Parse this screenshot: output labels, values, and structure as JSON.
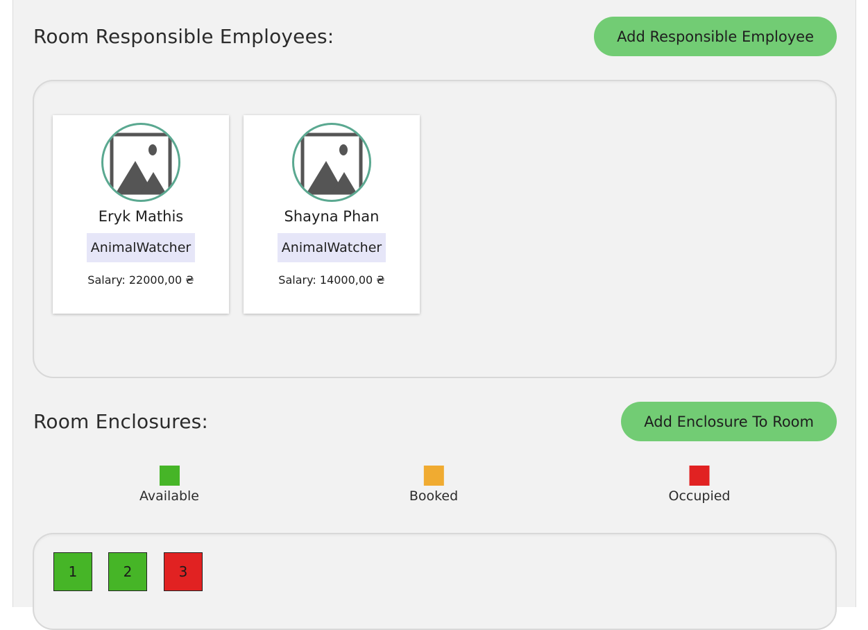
{
  "employees_section": {
    "title": "Room Responsible Employees:",
    "add_button_label": "Add Responsible Employee",
    "employees": [
      {
        "name": "Eryk Mathis",
        "role": "AnimalWatcher",
        "salary_label": "Salary:",
        "salary_value": "22000,00 ₴"
      },
      {
        "name": "Shayna Phan",
        "role": "AnimalWatcher",
        "salary_label": "Salary:",
        "salary_value": "14000,00 ₴"
      }
    ]
  },
  "enclosures_section": {
    "title": "Room Enclosures:",
    "add_button_label": "Add Enclosure To Room",
    "legend": [
      {
        "label": "Available",
        "color": "#46b527"
      },
      {
        "label": "Booked",
        "color": "#f0ab31"
      },
      {
        "label": "Occupied",
        "color": "#e12222"
      }
    ],
    "enclosures": [
      {
        "number": "1",
        "status": "Available",
        "color": "#46b527"
      },
      {
        "number": "2",
        "status": "Available",
        "color": "#46b527"
      },
      {
        "number": "3",
        "status": "Occupied",
        "color": "#e12222"
      }
    ]
  },
  "icons": {
    "avatar_placeholder": "image-placeholder-icon"
  }
}
